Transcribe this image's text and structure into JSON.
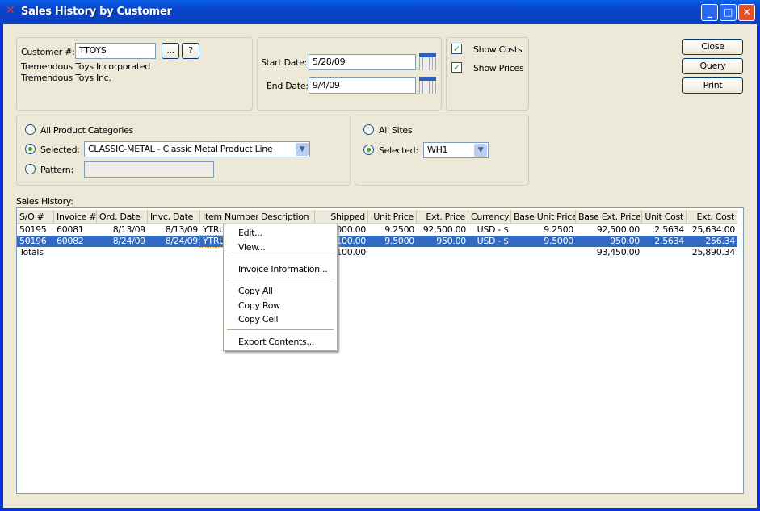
{
  "window": {
    "title": "Sales History by Customer"
  },
  "customer": {
    "label": "Customer #:",
    "value": "TTOYS",
    "lookup_label": "...",
    "help_label": "?",
    "name": "Tremendous Toys Incorporated",
    "short_name": "Tremendous Toys Inc."
  },
  "dates": {
    "start_label": "Start Date:",
    "start_value": "5/28/09",
    "end_label": "End Date:",
    "end_value": "9/4/09"
  },
  "options": {
    "show_costs": "Show Costs",
    "show_prices": "Show Prices"
  },
  "buttons": {
    "close": "Close",
    "query": "Query",
    "print": "Print"
  },
  "categories": {
    "all": "All Product Categories",
    "selected": "Selected:",
    "selected_value": "CLASSIC-METAL - Classic Metal Product Line",
    "pattern": "Pattern:"
  },
  "sites": {
    "all": "All Sites",
    "selected": "Selected:",
    "selected_value": "WH1"
  },
  "history": {
    "label": "Sales History:",
    "columns": [
      "S/O #",
      "Invoice #",
      "Ord. Date",
      "Invc. Date",
      "Item Number",
      "Description",
      "Shipped",
      "Unit Price",
      "Ext. Price",
      "Currency",
      "Base Unit Price",
      "Base Ext. Price",
      "Unit Cost",
      "Ext. Cost"
    ],
    "rows": [
      [
        "50195",
        "60081",
        "8/13/09",
        "8/13/09",
        "YTRU",
        "",
        "10,000.00",
        "9.2500",
        "92,500.00",
        "USD - $",
        "9.2500",
        "92,500.00",
        "2.5634",
        "25,634.00"
      ],
      [
        "50196",
        "60082",
        "8/24/09",
        "8/24/09",
        "YTRU",
        "",
        "100.00",
        "9.5000",
        "950.00",
        "USD - $",
        "9.5000",
        "950.00",
        "2.5634",
        "256.34"
      ],
      [
        "Totals",
        "",
        "",
        "",
        "",
        "",
        "10,100.00",
        "",
        "",
        "",
        "",
        "93,450.00",
        "",
        "25,890.34"
      ]
    ]
  },
  "context_menu": {
    "items": [
      "Edit...",
      "View...",
      "Invoice Information...",
      "Copy All",
      "Copy Row",
      "Copy Cell",
      "Export Contents..."
    ]
  },
  "colors": {
    "selection": "#316ac5",
    "titlebar": "#0a4fd8"
  }
}
